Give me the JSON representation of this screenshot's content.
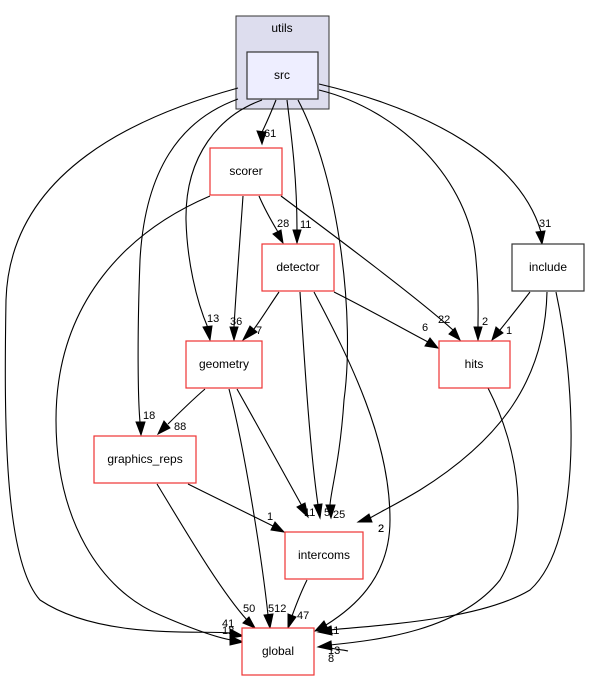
{
  "cluster": {
    "label": "utils",
    "fill": "#ddddee",
    "stroke": "#333333"
  },
  "nodes": [
    {
      "id": "src",
      "label": "src",
      "kind": "current",
      "fill": "#eeeeff",
      "stroke": "#333333"
    },
    {
      "id": "scorer",
      "label": "scorer",
      "kind": "dir",
      "stroke": "#ee3333"
    },
    {
      "id": "detector",
      "label": "detector",
      "kind": "dir",
      "stroke": "#ee3333"
    },
    {
      "id": "include",
      "label": "include",
      "kind": "plain",
      "stroke": "#333333"
    },
    {
      "id": "geometry",
      "label": "geometry",
      "kind": "dir",
      "stroke": "#ee3333"
    },
    {
      "id": "hits",
      "label": "hits",
      "kind": "dir",
      "stroke": "#ee3333"
    },
    {
      "id": "graphics_reps",
      "label": "graphics_reps",
      "kind": "dir",
      "stroke": "#ee3333"
    },
    {
      "id": "intercoms",
      "label": "intercoms",
      "kind": "dir",
      "stroke": "#ee3333"
    },
    {
      "id": "global",
      "label": "global",
      "kind": "dir",
      "stroke": "#ee3333"
    }
  ],
  "edges": [
    {
      "from": "src",
      "to": "scorer",
      "label": "61"
    },
    {
      "from": "src",
      "to": "detector",
      "label": "11"
    },
    {
      "from": "src",
      "to": "geometry",
      "label": "13"
    },
    {
      "from": "src",
      "to": "graphics_reps",
      "label": "18"
    },
    {
      "from": "src",
      "to": "hits",
      "label": "2"
    },
    {
      "from": "src",
      "to": "include",
      "label": "31"
    },
    {
      "from": "src",
      "to": "intercoms",
      "label": "25"
    },
    {
      "from": "src",
      "to": "global",
      "label": "41"
    },
    {
      "from": "scorer",
      "to": "detector",
      "label": "28"
    },
    {
      "from": "scorer",
      "to": "geometry",
      "label": "36"
    },
    {
      "from": "scorer",
      "to": "hits",
      "label": "22"
    },
    {
      "from": "scorer",
      "to": "global",
      "label": "12"
    },
    {
      "from": "detector",
      "to": "geometry",
      "label": "7"
    },
    {
      "from": "detector",
      "to": "hits",
      "label": "6"
    },
    {
      "from": "detector",
      "to": "intercoms",
      "label": "5"
    },
    {
      "from": "detector",
      "to": "global",
      "label": "2"
    },
    {
      "from": "geometry",
      "to": "graphics_reps",
      "label": "88"
    },
    {
      "from": "geometry",
      "to": "intercoms",
      "label": "11"
    },
    {
      "from": "geometry",
      "to": "global",
      "label": "512"
    },
    {
      "from": "graphics_reps",
      "to": "intercoms",
      "label": "1"
    },
    {
      "from": "graphics_reps",
      "to": "global",
      "label": "50"
    },
    {
      "from": "include",
      "to": "hits",
      "label": "1"
    },
    {
      "from": "include",
      "to": "intercoms",
      "label": "2"
    },
    {
      "from": "include",
      "to": "global",
      "label": "11"
    },
    {
      "from": "intercoms",
      "to": "global",
      "label": "47"
    },
    {
      "from": "hits",
      "to": "global",
      "label": "13"
    },
    {
      "from": "include",
      "to": "global",
      "label": "8"
    }
  ]
}
